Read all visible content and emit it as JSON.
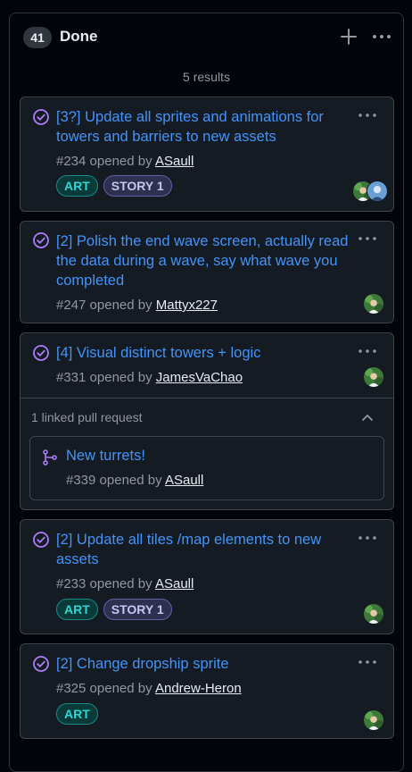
{
  "column": {
    "count": "41",
    "title": "Done",
    "results_text": "5 results"
  },
  "icons": {
    "add": "plus-icon",
    "more": "kebab-horizontal-icon",
    "status": "check-circle-icon",
    "pull_request": "git-pull-request-icon",
    "collapse": "chevron-up-icon"
  },
  "colors": {
    "background": "#010409",
    "card": "#151b23",
    "link": "#4493f8",
    "done_purple": "#ab7df8",
    "label_art": "#2fd6d1",
    "label_story": "#c5c7f0"
  },
  "cards": [
    {
      "title": "[3?] Update all sprites and animations for towers and barriers to new assets",
      "number": "#234",
      "opened_by": "opened by",
      "author": "ASaull",
      "labels": [
        "ART",
        "STORY 1"
      ]
    },
    {
      "title": "[2] Polish the end wave screen, actually read the data during a wave, say what wave you completed",
      "number": "#247",
      "opened_by": "opened by",
      "author": "Mattyx227",
      "labels": []
    },
    {
      "title": "[4] Visual distinct towers + logic",
      "number": "#331",
      "opened_by": "opened by",
      "author": "JamesVaChao",
      "labels": [],
      "linked": {
        "header": "1 linked pull request",
        "pr_title": "New turrets!",
        "pr_number": "#339",
        "pr_opened_by": "opened by",
        "pr_author": "ASaull"
      }
    },
    {
      "title": "[2] Update all tiles /map elements to new assets",
      "number": "#233",
      "opened_by": "opened by",
      "author": "ASaull",
      "labels": [
        "ART",
        "STORY 1"
      ]
    },
    {
      "title": "[2] Change dropship sprite",
      "number": "#325",
      "opened_by": "opened by",
      "author": "Andrew-Heron",
      "labels": [
        "ART"
      ]
    }
  ]
}
